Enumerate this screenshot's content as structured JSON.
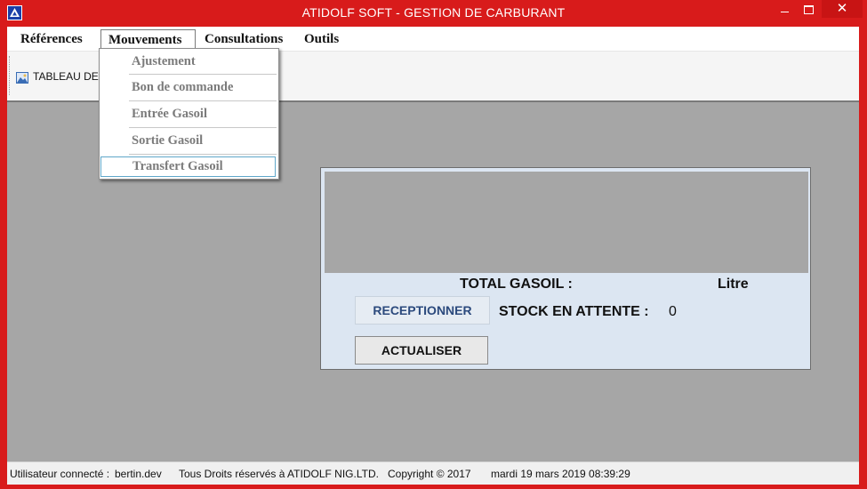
{
  "window": {
    "title": "ATIDOLF SOFT - GESTION DE CARBURANT",
    "minimize_label": "",
    "maximize_label": "",
    "close_label": "✕"
  },
  "menu": {
    "references": "Références",
    "mouvements": "Mouvements",
    "consultations": "Consultations",
    "outils": "Outils"
  },
  "dropdown": {
    "items": [
      "Ajustement",
      "Bon de commande",
      "Entrée Gasoil",
      "Sortie Gasoil",
      "Transfert Gasoil"
    ]
  },
  "toolbar": {
    "tableau_label": "TABLEAU DE BORD"
  },
  "panel": {
    "total_label": "TOTAL GASOIL :",
    "total_unit": "Litre",
    "reception_button": "RECEPTIONNER",
    "stock_label": "STOCK EN ATTENTE :",
    "stock_value": "0",
    "actualiser_button": "ACTUALISER"
  },
  "status": {
    "user_label": "Utilisateur connecté :",
    "user_value": "bertin.dev",
    "rights": "Tous Droits réservés à ATIDOLF NIG.LTD.",
    "copyright": "Copyright © 2017",
    "datetime": "mardi 19 mars 2019 08:39:29"
  },
  "colors": {
    "frame": "#d81b1b",
    "client": "#a6a6a6",
    "panel": "#dce6f2",
    "selection_border": "#5fa7c9"
  }
}
